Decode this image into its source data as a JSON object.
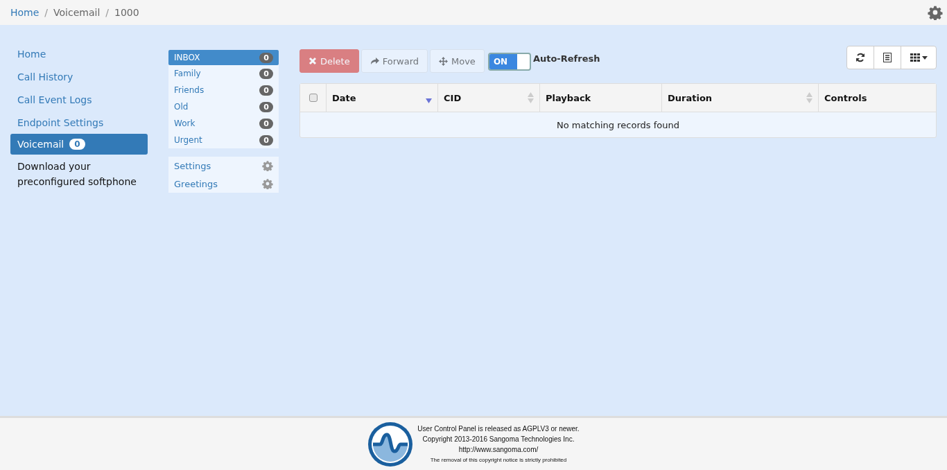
{
  "breadcrumb": [
    {
      "kind": "link",
      "label": "Home"
    },
    {
      "kind": "separator",
      "label": "/"
    },
    {
      "kind": "text",
      "label": "Voicemail"
    },
    {
      "kind": "separator",
      "label": "/"
    },
    {
      "kind": "text",
      "label": "1000"
    }
  ],
  "nav": [
    {
      "label": "Home",
      "selected": false
    },
    {
      "label": "Call History",
      "selected": false
    },
    {
      "label": "Call Event Logs",
      "selected": false
    },
    {
      "label": "Endpoint Settings",
      "selected": false
    },
    {
      "label": "Voicemail",
      "selected": true,
      "badge": "0"
    }
  ],
  "nav_note": "Download your preconfigured softphone",
  "folders": [
    {
      "label": "INBOX",
      "count": "0",
      "selected": true
    },
    {
      "label": "Family",
      "count": "0",
      "selected": false
    },
    {
      "label": "Friends",
      "count": "0",
      "selected": false
    },
    {
      "label": "Old",
      "count": "0",
      "selected": false
    },
    {
      "label": "Work",
      "count": "0",
      "selected": false
    },
    {
      "label": "Urgent",
      "count": "0",
      "selected": false
    }
  ],
  "folder_settings": [
    {
      "label": "Settings"
    },
    {
      "label": "Greetings"
    }
  ],
  "toolbar": {
    "buttons": [
      {
        "kind": "delete",
        "label": "Delete",
        "disabled": true
      },
      {
        "kind": "forward",
        "label": "Forward",
        "disabled": true
      },
      {
        "kind": "move",
        "label": "Move",
        "disabled": true
      }
    ],
    "toggle": {
      "label": "ON",
      "on": true
    },
    "toggle_caption": "Auto-Refresh"
  },
  "table": {
    "columns": [
      {
        "label": "Date",
        "sorted": true
      },
      {
        "label": "CID",
        "sorted": false
      },
      {
        "label": "Playback"
      },
      {
        "label": "Duration",
        "sorted": false
      },
      {
        "label": "Controls"
      }
    ],
    "select_all": {
      "checked": false
    },
    "empty_message": "No matching records found"
  },
  "footer": [
    "User Control Panel is released as AGPLV3 or newer.",
    "Copyright 2013-2016 Sangoma Technologies Inc.",
    "http://www.sangoma.com/",
    "The removal of this copyright notice is strictly prohibited"
  ]
}
